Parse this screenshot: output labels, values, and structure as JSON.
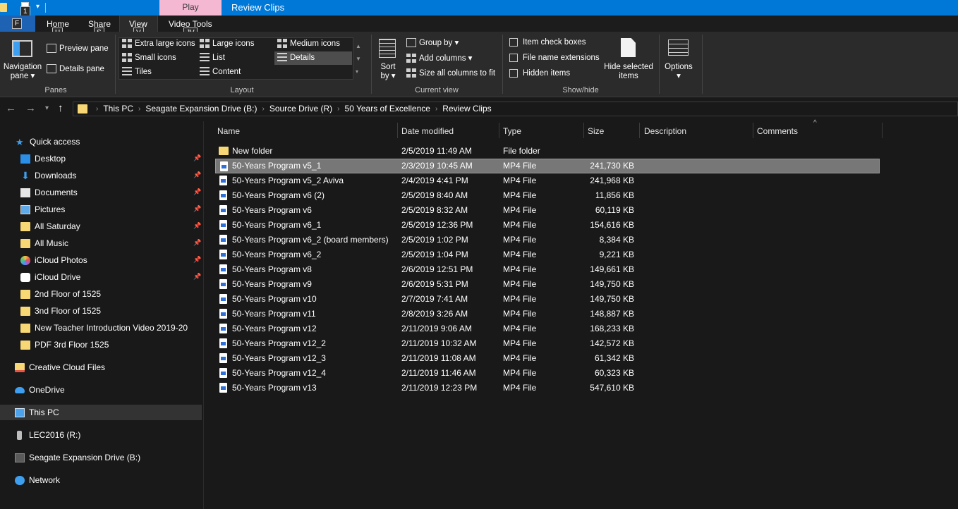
{
  "title_bar": {
    "contextual_tab": "Play",
    "window_title": "Review Clips",
    "keytip_qat": "1"
  },
  "ribbon_tabs": {
    "file_keytip": "F",
    "home": "Home",
    "home_keytip": "H",
    "share": "Share",
    "share_keytip": "S",
    "view": "View",
    "view_keytip": "V",
    "video_tools": "Video Tools",
    "video_tools_keytip": "JV"
  },
  "ribbon": {
    "panes": {
      "label": "Panes",
      "navigation_pane_line1": "Navigation",
      "navigation_pane_line2": "pane ▾",
      "preview_pane": "Preview pane",
      "details_pane": "Details pane"
    },
    "layout": {
      "label": "Layout",
      "extra_large_icons": "Extra large icons",
      "large_icons": "Large icons",
      "medium_icons": "Medium icons",
      "small_icons": "Small icons",
      "list": "List",
      "details": "Details",
      "tiles": "Tiles",
      "content": "Content"
    },
    "current_view": {
      "label": "Current view",
      "sort_line1": "Sort",
      "sort_line2": "by ▾",
      "group_by": "Group by ▾",
      "add_columns": "Add columns ▾",
      "size_all_columns": "Size all columns to fit"
    },
    "show_hide": {
      "label": "Show/hide",
      "item_check_boxes": "Item check boxes",
      "file_name_extensions": "File name extensions",
      "hidden_items": "Hidden items",
      "hide_selected_line1": "Hide selected",
      "hide_selected_line2": "items"
    },
    "options": {
      "label": "Options",
      "arrow": "▾"
    }
  },
  "address_bar": {
    "crumbs": [
      "This PC",
      "Seagate Expansion Drive (B:)",
      "Source Drive (R)",
      "50 Years of Excellence",
      "Review Clips"
    ]
  },
  "sidebar": {
    "items": [
      {
        "label": "Quick access",
        "icon": "star-icon"
      },
      {
        "label": "Desktop",
        "icon": "desktop-icon"
      },
      {
        "label": "Downloads",
        "icon": "download-icon"
      },
      {
        "label": "Documents",
        "icon": "documents-icon"
      },
      {
        "label": "Pictures",
        "icon": "pictures-icon"
      },
      {
        "label": "All Saturday",
        "icon": "folder-icon"
      },
      {
        "label": "All Music",
        "icon": "folder-icon"
      },
      {
        "label": "iCloud Photos",
        "icon": "icloud-photos-icon"
      },
      {
        "label": "iCloud Drive",
        "icon": "icloud-drive-icon"
      },
      {
        "label": "2nd Floor of 1525",
        "icon": "folder-icon"
      },
      {
        "label": "3nd Floor of 1525",
        "icon": "folder-icon"
      },
      {
        "label": "New Teacher Introduction Video 2019-20",
        "icon": "folder-icon"
      },
      {
        "label": "PDF 3rd Floor 1525",
        "icon": "folder-icon"
      },
      {
        "label": "Creative Cloud Files",
        "icon": "creative-cloud-icon"
      },
      {
        "label": "OneDrive",
        "icon": "onedrive-icon"
      },
      {
        "label": "This PC",
        "icon": "computer-icon"
      },
      {
        "label": "LEC2016 (R:)",
        "icon": "drive-icon"
      },
      {
        "label": "Seagate Expansion Drive (B:)",
        "icon": "drive-icon"
      },
      {
        "label": "Network",
        "icon": "network-icon"
      }
    ]
  },
  "file_list": {
    "columns": [
      "Name",
      "Date modified",
      "Type",
      "Size",
      "Description",
      "Comments"
    ],
    "sort_indicator": "^",
    "rows": [
      {
        "name": "New folder",
        "date": "2/5/2019 11:49 AM",
        "type": "File folder",
        "size": "",
        "kind": "folder"
      },
      {
        "name": "50-Years Program v5_1",
        "date": "2/3/2019 10:45 AM",
        "type": "MP4 File",
        "size": "241,730 KB",
        "kind": "file",
        "selected": true
      },
      {
        "name": "50-Years Program v5_2 Aviva",
        "date": "2/4/2019 4:41 PM",
        "type": "MP4 File",
        "size": "241,968 KB",
        "kind": "file"
      },
      {
        "name": "50-Years Program v6 (2)",
        "date": "2/5/2019 8:40 AM",
        "type": "MP4 File",
        "size": "11,856 KB",
        "kind": "file"
      },
      {
        "name": "50-Years Program v6",
        "date": "2/5/2019 8:32 AM",
        "type": "MP4 File",
        "size": "60,119 KB",
        "kind": "file"
      },
      {
        "name": "50-Years Program v6_1",
        "date": "2/5/2019 12:36 PM",
        "type": "MP4 File",
        "size": "154,616 KB",
        "kind": "file"
      },
      {
        "name": "50-Years Program v6_2 (board members)",
        "date": "2/5/2019 1:02 PM",
        "type": "MP4 File",
        "size": "8,384 KB",
        "kind": "file"
      },
      {
        "name": "50-Years Program v6_2",
        "date": "2/5/2019 1:04 PM",
        "type": "MP4 File",
        "size": "9,221 KB",
        "kind": "file"
      },
      {
        "name": "50-Years Program v8",
        "date": "2/6/2019 12:51 PM",
        "type": "MP4 File",
        "size": "149,661 KB",
        "kind": "file"
      },
      {
        "name": "50-Years Program v9",
        "date": "2/6/2019 5:31 PM",
        "type": "MP4 File",
        "size": "149,750 KB",
        "kind": "file"
      },
      {
        "name": "50-Years Program v10",
        "date": "2/7/2019 7:41 AM",
        "type": "MP4 File",
        "size": "149,750 KB",
        "kind": "file"
      },
      {
        "name": "50-Years Program v11",
        "date": "2/8/2019 3:26 AM",
        "type": "MP4 File",
        "size": "148,887 KB",
        "kind": "file"
      },
      {
        "name": "50-Years Program v12",
        "date": "2/11/2019 9:06 AM",
        "type": "MP4 File",
        "size": "168,233 KB",
        "kind": "file"
      },
      {
        "name": "50-Years Program v12_2",
        "date": "2/11/2019 10:32 AM",
        "type": "MP4 File",
        "size": "142,572 KB",
        "kind": "file"
      },
      {
        "name": "50-Years Program v12_3",
        "date": "2/11/2019 11:08 AM",
        "type": "MP4 File",
        "size": "61,342 KB",
        "kind": "file"
      },
      {
        "name": "50-Years Program v12_4",
        "date": "2/11/2019 11:46 AM",
        "type": "MP4 File",
        "size": "60,323 KB",
        "kind": "file"
      },
      {
        "name": "50-Years Program v13",
        "date": "2/11/2019 12:23 PM",
        "type": "MP4 File",
        "size": "547,610 KB",
        "kind": "file"
      }
    ]
  },
  "colors": {
    "title_bar": "#0078d7",
    "contextual_tab": "#f4b8d2",
    "background": "#191919",
    "ribbon": "#2b2b2b",
    "selection": "#777777",
    "folder": "#f8d775"
  }
}
